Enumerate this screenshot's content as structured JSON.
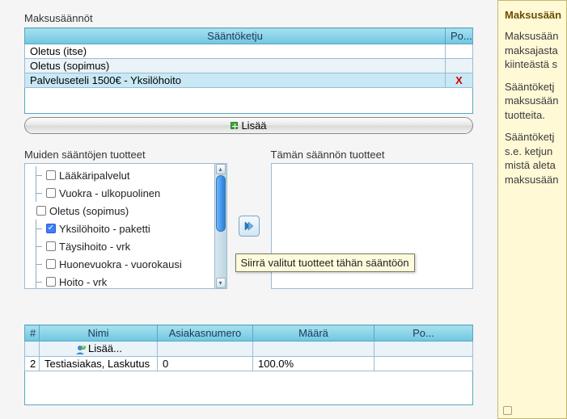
{
  "title": "Maksusäännöt",
  "rule_table": {
    "header_rule": "Sääntöketju",
    "header_delete": "Po...",
    "rows": [
      {
        "name": "Oletus (itse)",
        "del": ""
      },
      {
        "name": "Oletus (sopimus)",
        "del": ""
      },
      {
        "name": "Palveluseteli 1500€ - Yksilöhoito",
        "del": "X"
      }
    ]
  },
  "add_button": "Lisää",
  "left_list_title": "Muiden sääntöjen tuotteet",
  "right_list_title": "Tämän säännön tuotteet",
  "tree": [
    {
      "indent": 1,
      "checked": false,
      "label": "Lääkäripalvelut"
    },
    {
      "indent": 1,
      "checked": false,
      "label": "Vuokra - ulkopuolinen"
    },
    {
      "indent": 0,
      "checked": false,
      "label": "Oletus (sopimus)"
    },
    {
      "indent": 1,
      "checked": true,
      "label": "Yksilöhoito - paketti"
    },
    {
      "indent": 1,
      "checked": false,
      "label": "Täysihoito - vrk"
    },
    {
      "indent": 1,
      "checked": false,
      "label": "Huonevuokra - vuorokausi"
    },
    {
      "indent": 1,
      "checked": false,
      "label": "Hoito - vrk"
    }
  ],
  "tooltip": "Siirrä valitut tuotteet tähän sääntöön",
  "payer_table": {
    "h_idx": "#",
    "h_name": "Nimi",
    "h_cust": "Asiakasnumero",
    "h_amt": "Määrä",
    "h_del": "Po...",
    "rows": [
      {
        "idx": "",
        "name": "Lisää...",
        "cust": "",
        "amt": "",
        "add": true
      },
      {
        "idx": "2",
        "name": "Testiasiakas, Laskutus",
        "cust": "0",
        "amt": "100.0%",
        "add": false
      }
    ]
  },
  "help": {
    "title": "Maksusään",
    "p1": "Maksusään\nmaksajasta\nkiinteästä s",
    "p2": "Sääntöketj\nmaksusään\ntuotteita.",
    "p3": "Sääntöketj\ns.e. ketjun\nmistä aleta\nmaksusään"
  }
}
